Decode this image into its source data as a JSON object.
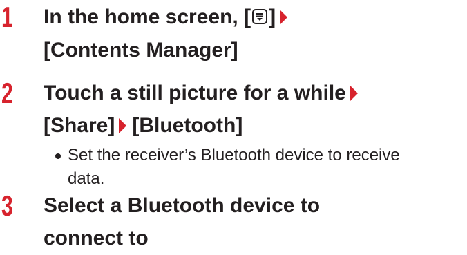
{
  "steps": [
    {
      "number": "1",
      "line1_before": "In the home screen, [",
      "menu_icon": "menu-key-icon",
      "line1_after": "]",
      "line2": "[Contents Manager]"
    },
    {
      "number": "2",
      "line1": "Touch a still picture for a while",
      "line2_part1": "[Share]",
      "line2_part2": "[Bluetooth]",
      "note_line1": "Set the receiver’s Bluetooth device to receive",
      "note_line2": "data."
    },
    {
      "number": "3",
      "line1": "Select a Bluetooth device to",
      "line2": "connect to"
    }
  ],
  "colors": {
    "accent": "#d7232d",
    "text": "#231f20"
  }
}
